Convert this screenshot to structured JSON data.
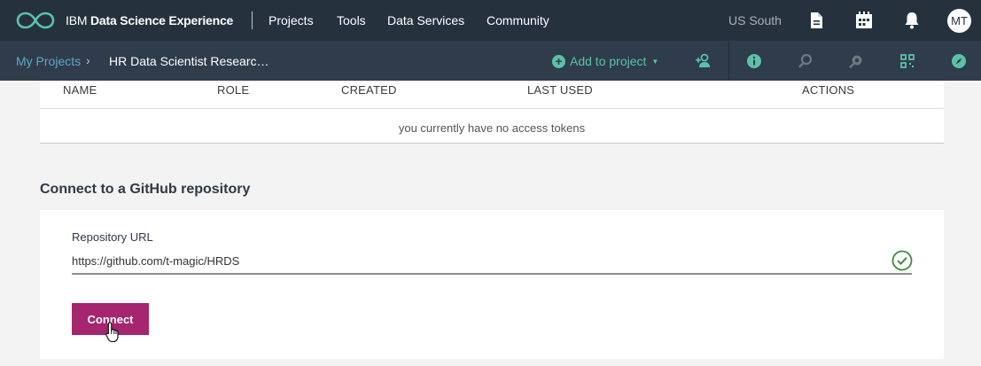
{
  "topbar": {
    "brand_plain": "IBM ",
    "brand_bold": "Data Science Experience",
    "nav": [
      "Projects",
      "Tools",
      "Data Services",
      "Community"
    ],
    "region": "US South",
    "user_initials": "MT"
  },
  "subbar": {
    "breadcrumb_link": "My Projects",
    "breadcrumb_sep": "›",
    "breadcrumb_current": "HR Data Scientist Researc…",
    "add_to_project": "Add to project",
    "add_icon": "plus-circle-icon"
  },
  "tokens_table": {
    "columns": [
      "NAME",
      "ROLE",
      "CREATED",
      "LAST USED",
      "ACTIONS"
    ],
    "empty_message": "you currently have no access tokens"
  },
  "github": {
    "section_title": "Connect to a GitHub repository",
    "field_label": "Repository URL",
    "field_value": "https://github.com/t-magic/HRDS",
    "connect_label": "Connect"
  },
  "colors": {
    "topbar_bg": "#26313e",
    "subbar_bg": "#2f3c4b",
    "accent_green": "#5bc2a8",
    "link_blue": "#5aa9c8",
    "connect_button": "#a5256f",
    "valid_check": "#3e8a3a"
  }
}
